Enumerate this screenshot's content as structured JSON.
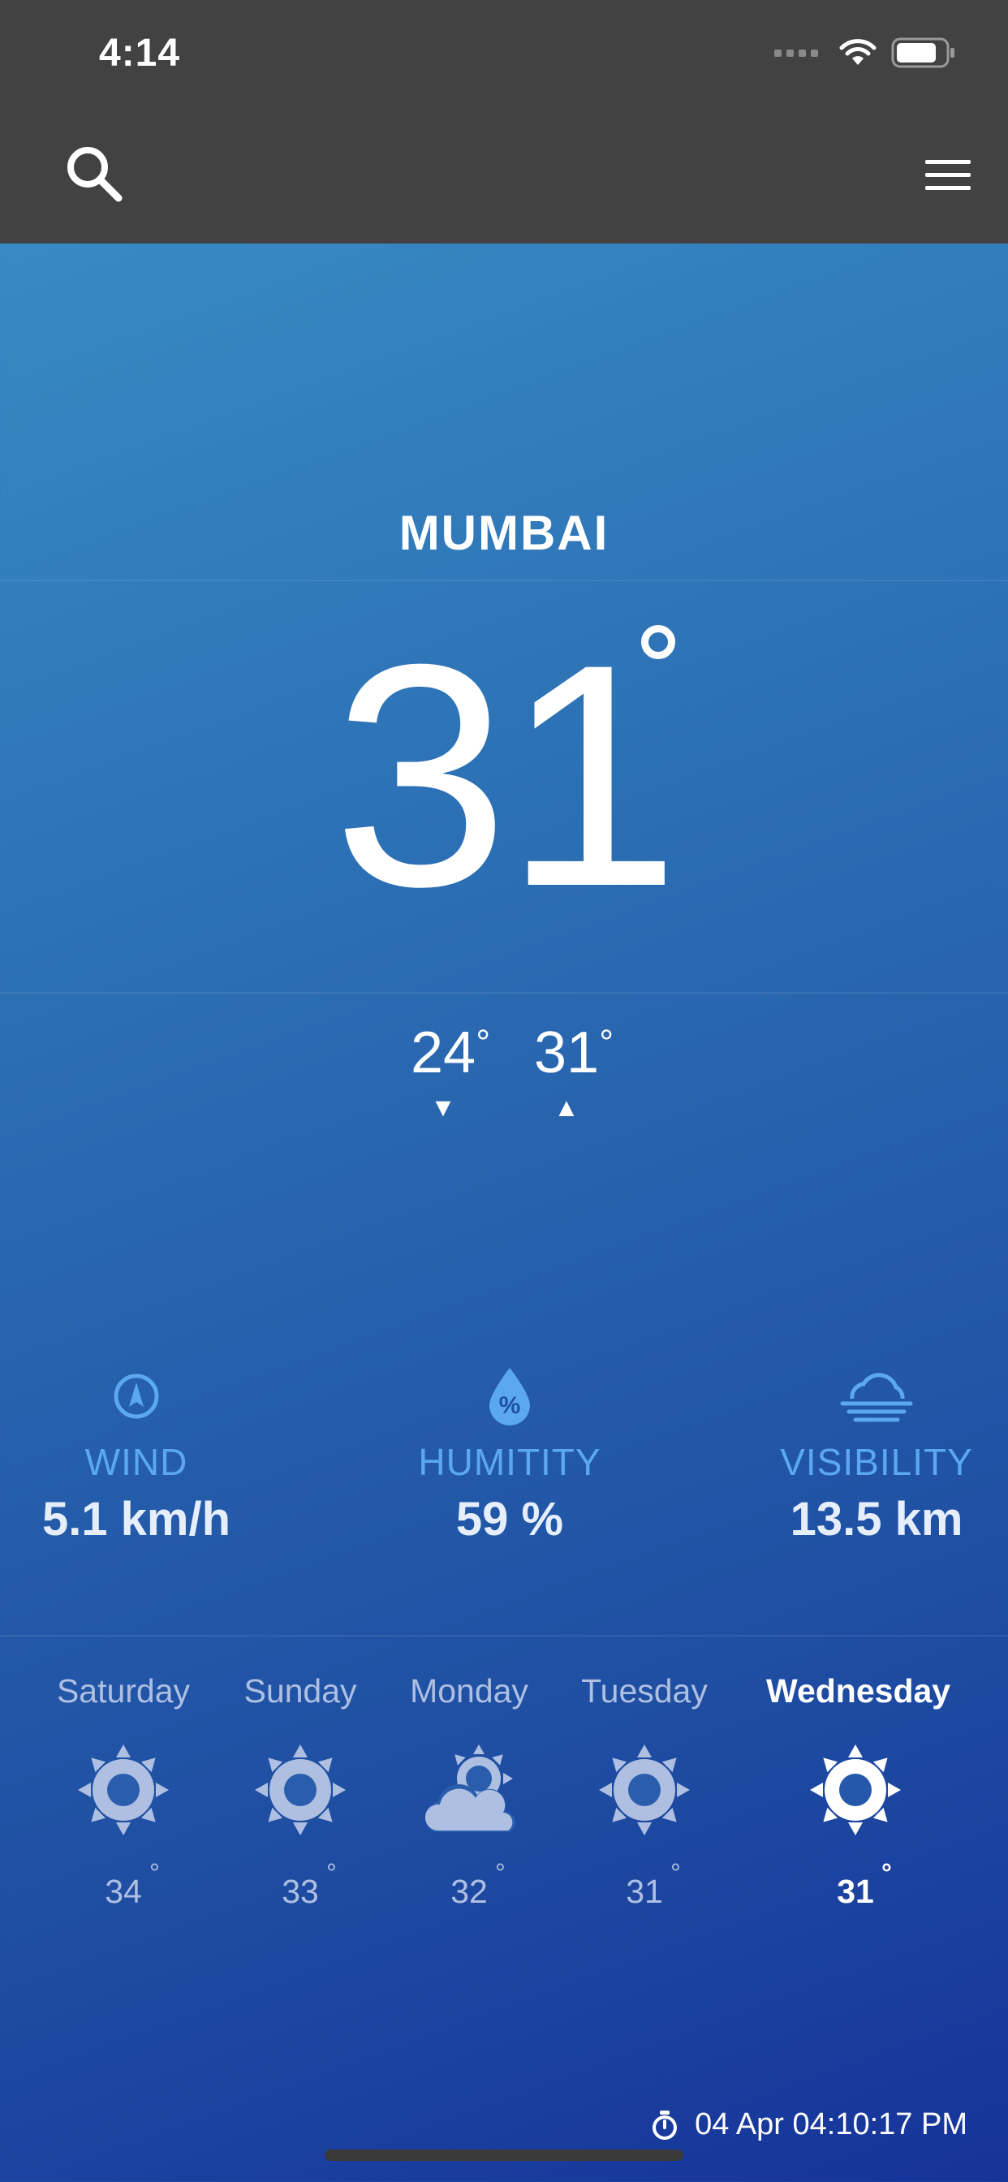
{
  "status_bar": {
    "time": "4:14"
  },
  "header": {
    "search_icon": "search-icon",
    "menu_icon": "hamburger-menu-icon"
  },
  "current": {
    "city": "MUMBAI",
    "temperature": "31",
    "min_temp": "24",
    "max_temp": "31",
    "degree_symbol": "°"
  },
  "stats": [
    {
      "label": "WIND",
      "value": "5.1 km/h",
      "icon": "compass-icon"
    },
    {
      "label": "HUMITITY",
      "value": "59 %",
      "icon": "humidity-drop-icon"
    },
    {
      "label": "VISIBILITY",
      "value": "13.5 km",
      "icon": "fog-icon"
    }
  ],
  "forecast": [
    {
      "day": "Saturday",
      "temp": "34",
      "icon": "sun-icon"
    },
    {
      "day": "Sunday",
      "temp": "33",
      "icon": "sun-icon"
    },
    {
      "day": "Monday",
      "temp": "32",
      "icon": "partly-cloudy-icon"
    },
    {
      "day": "Tuesday",
      "temp": "31",
      "icon": "sun-icon"
    },
    {
      "day": "Wednesday",
      "temp": "31",
      "icon": "sun-icon",
      "active": true
    }
  ],
  "updated": {
    "text": "04 Apr 04:10:17 PM",
    "icon": "timer-icon"
  },
  "colors": {
    "topbar": "#424242",
    "stat_label": "#5ba8f0",
    "inactive_day": "#aebfe2",
    "active_day": "#ffffff"
  }
}
